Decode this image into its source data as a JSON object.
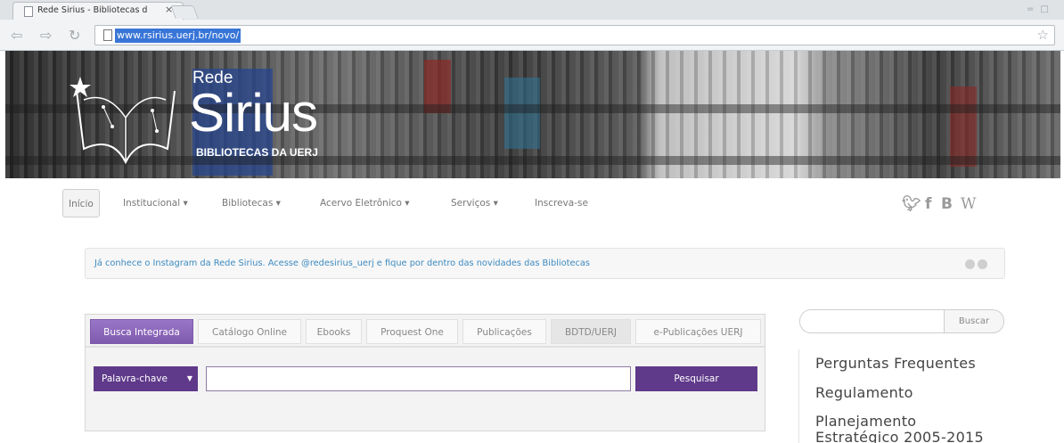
{
  "browser": {
    "tab_title": "Rede Sirius - Bibliotecas d",
    "tab_close": "×",
    "url": "www.rsirius.uerj.br/novo/",
    "window_controls": "= □"
  },
  "banner": {
    "logo_line1": "Rede",
    "logo_line2": "Sirius",
    "logo_line3": "BIBLIOTECAS DA UERJ"
  },
  "nav": {
    "items": [
      {
        "label": "Início"
      },
      {
        "label": "Institucional ▾"
      },
      {
        "label": "Bibliotecas ▾"
      },
      {
        "label": "Acervo Eletrônico ▾"
      },
      {
        "label": "Serviços ▾"
      },
      {
        "label": "Inscreva-se"
      }
    ],
    "social": [
      "twitter-icon",
      "facebook-icon",
      "blogger-icon",
      "wikipedia-icon"
    ]
  },
  "notice": {
    "text": "Já conhece o Instagram da Rede Sirius. Acesse @redesirius_uerj e fique por dentro das novidades das Bibliotecas"
  },
  "search": {
    "tabs": [
      {
        "label": "Busca Integrada"
      },
      {
        "label": "Catálogo Online"
      },
      {
        "label": "Ebooks"
      },
      {
        "label": "Proquest One"
      },
      {
        "label": "Publicações"
      },
      {
        "label": "BDTD/UERJ"
      },
      {
        "label": "e-Publicações UERJ"
      }
    ],
    "select_value": "Palavra-chave",
    "input_value": "",
    "button_label": "Pesquisar"
  },
  "sidebar": {
    "search_value": "",
    "search_button": "Buscar",
    "links": [
      {
        "label": "Perguntas Frequentes"
      },
      {
        "label": "Regulamento"
      },
      {
        "label": "Planejamento"
      },
      {
        "label": "Estratégico 2005-2015"
      }
    ]
  },
  "colors": {
    "accent": "#5f3a8a",
    "active_tab": "#8f68bd",
    "link": "#3c8abf",
    "url_highlight": "#3875d7"
  }
}
